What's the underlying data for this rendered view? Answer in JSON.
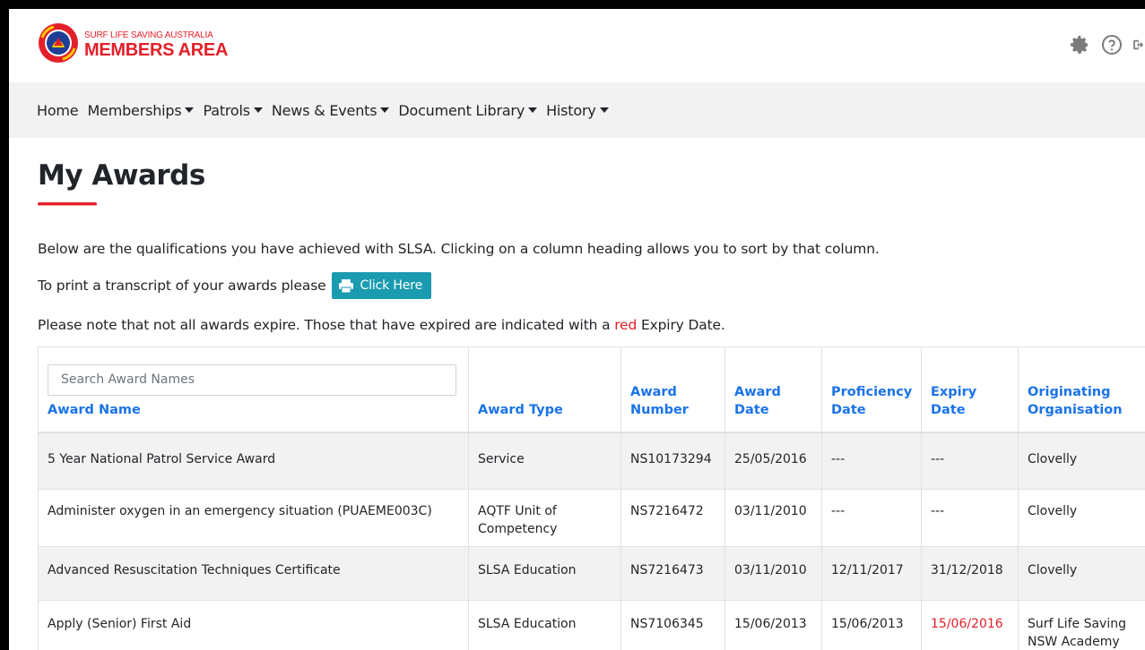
{
  "brand": {
    "top": "SURF LIFE SAVING AUSTRALIA",
    "main": "MEMBERS AREA"
  },
  "nav": [
    {
      "label": "Home",
      "dropdown": false
    },
    {
      "label": "Memberships",
      "dropdown": true
    },
    {
      "label": "Patrols",
      "dropdown": true
    },
    {
      "label": "News & Events",
      "dropdown": true
    },
    {
      "label": "Document Library",
      "dropdown": true
    },
    {
      "label": "History",
      "dropdown": true
    }
  ],
  "page": {
    "title": "My Awards",
    "intro": "Below are the qualifications you have achieved with SLSA. Clicking on a column heading allows you to sort by that column.",
    "print_text": "To print a transcript of your awards please",
    "print_button": "Click Here",
    "note_before": "Please note that not all awards expire. Those that have expired are indicated with a ",
    "note_red": "red",
    "note_after": " Expiry Date."
  },
  "table": {
    "search_placeholder": "Search Award Names",
    "headers": {
      "award_name": "Award Name",
      "award_type": "Award Type",
      "award_number_1": "Award",
      "award_number_2": "Number",
      "award_date_1": "Award",
      "award_date_2": "Date",
      "proficiency_1": "Proficiency",
      "proficiency_2": "Date",
      "expiry_1": "Expiry",
      "expiry_2": "Date",
      "org_1": "Originating",
      "org_2": "Organisation"
    },
    "rows": [
      {
        "name": "5 Year National Patrol Service Award",
        "type": "Service",
        "number": "NS10173294",
        "award_date": "25/05/2016",
        "proficiency": "---",
        "expiry": "---",
        "org": "Clovelly",
        "expired": false
      },
      {
        "name": "Administer oxygen in an emergency situation (PUAEME003C)",
        "type": "AQTF Unit of Competency",
        "number": "NS7216472",
        "award_date": "03/11/2010",
        "proficiency": "---",
        "expiry": "---",
        "org": "Clovelly",
        "expired": false
      },
      {
        "name": "Advanced Resuscitation Techniques Certificate",
        "type": "SLSA Education",
        "number": "NS7216473",
        "award_date": "03/11/2010",
        "proficiency": "12/11/2017",
        "expiry": "31/12/2018",
        "org": "Clovelly",
        "expired": false
      },
      {
        "name": "Apply (Senior) First Aid",
        "type": "SLSA Education",
        "number": "NS7106345",
        "award_date": "15/06/2013",
        "proficiency": "15/06/2013",
        "expiry": "15/06/2016",
        "org": "Surf Life Saving NSW Academy",
        "expired": true
      }
    ]
  },
  "colors": {
    "brand_red": "#e3202a",
    "link_blue": "#1a73e8",
    "button_teal": "#1a9bb0"
  },
  "icons": [
    "gear-icon",
    "help-icon",
    "logout-icon",
    "printer-icon"
  ]
}
